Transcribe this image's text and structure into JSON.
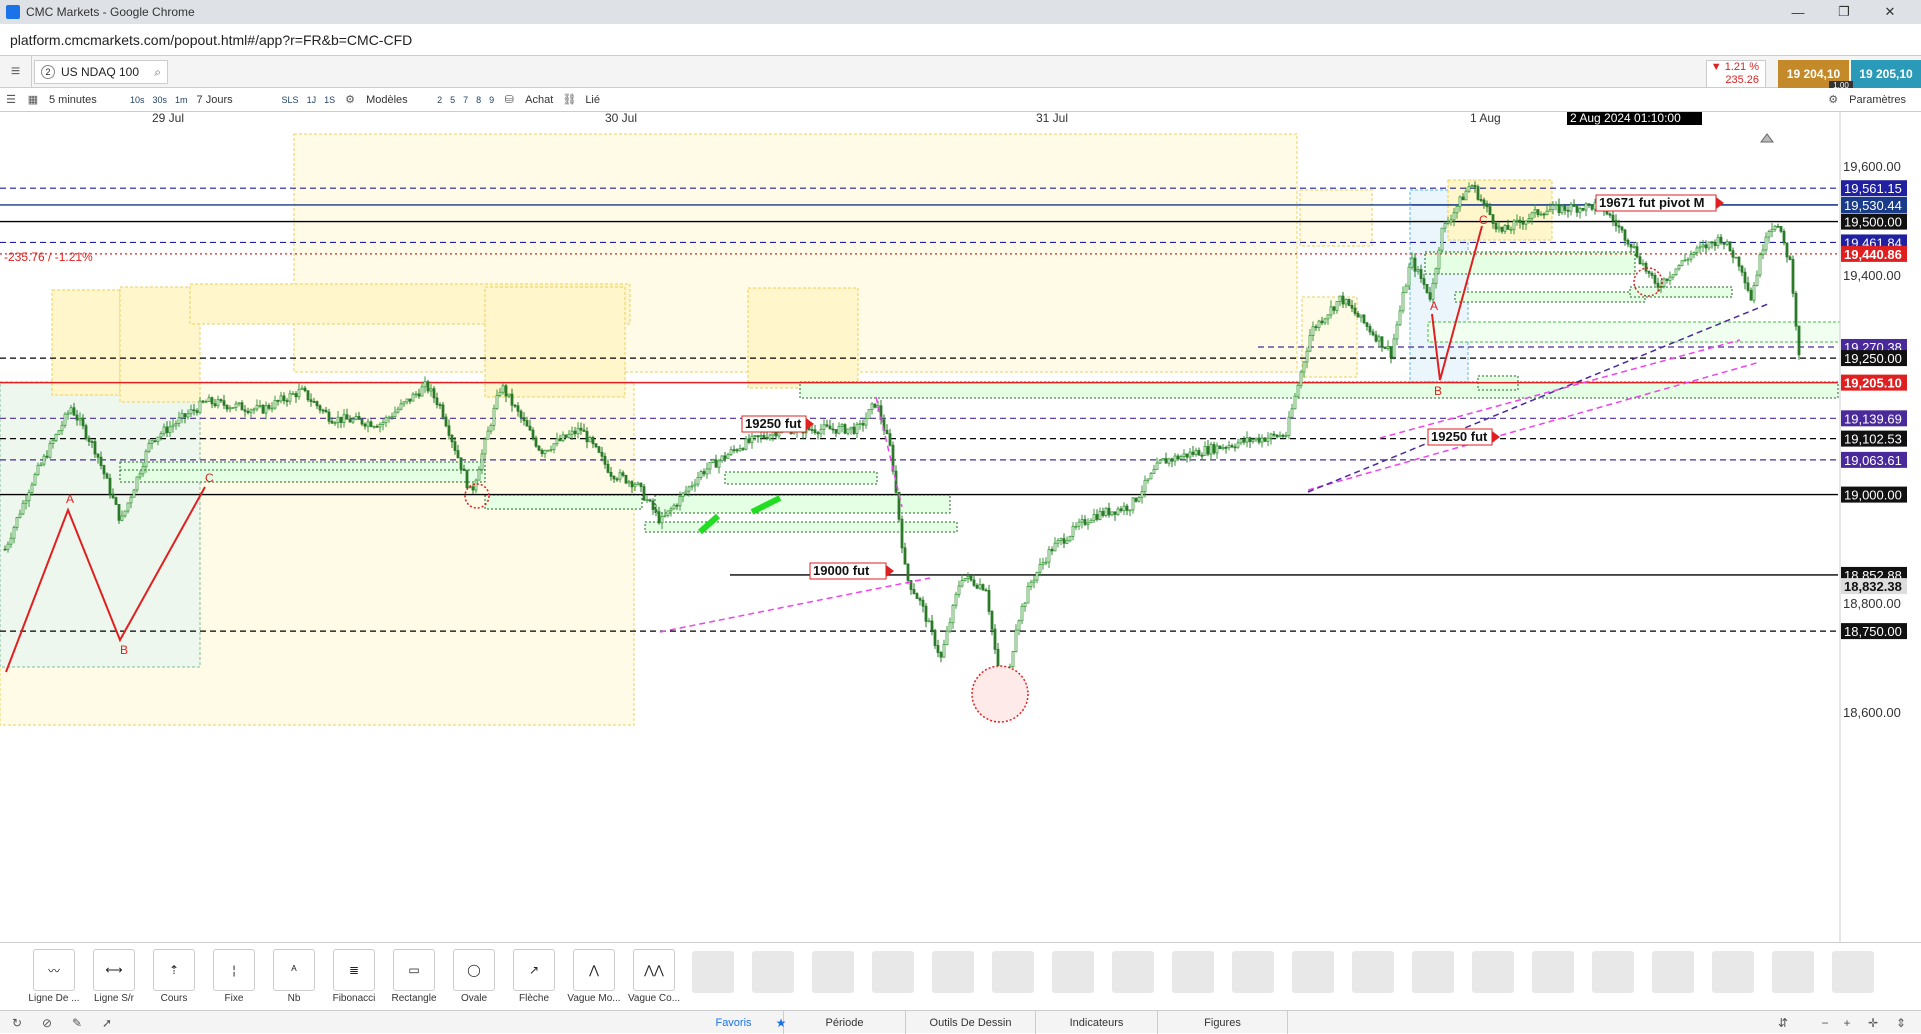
{
  "window": {
    "title": "CMC Markets - Google Chrome",
    "url": "platform.cmcmarkets.com/popout.html#/app?r=FR&b=CMC-CFD"
  },
  "instrument": {
    "tab_number": "2",
    "name": "US NDAQ 100",
    "change_pct": "▼ 1.21 %",
    "change_pts": "235.26",
    "sell": "19 204,10",
    "buy": "19 205,10",
    "spread": "1.00"
  },
  "toolbar": {
    "interval": "5 minutes",
    "btn_10s": "10s",
    "btn_30s": "30s",
    "btn_1m": "1m",
    "range": "7 Jours",
    "sls": "SLS",
    "btn_1j": "1J",
    "btn_1s": "1S",
    "models": "Modèles",
    "n2": "2",
    "n5": "5",
    "n7": "7",
    "n8": "8",
    "n9": "9",
    "achat": "Achat",
    "lie": "Lié",
    "params": "Paramètres"
  },
  "chart_data": {
    "type": "candlestick",
    "x_labels": [
      "29 Jul",
      "30 Jul",
      "31 Jul",
      "1 Aug"
    ],
    "crosshair_time": "2 Aug 2024 01:10:00",
    "y_ticks": [
      "19,600.00",
      "19,400.00",
      "18,800.00",
      "18,600.00"
    ],
    "ylim": [
      18550,
      19720
    ],
    "change_label": "-235.76 / -1.21%",
    "price_levels": [
      {
        "label": "19,561.15",
        "value": 19561.15,
        "style": "dashed",
        "color": "#2020a0"
      },
      {
        "label": "19,530.44",
        "value": 19530.44,
        "style": "solid",
        "color": "#1a3a8a"
      },
      {
        "label": "19,500.00",
        "value": 19500,
        "style": "solid",
        "color": "#000000"
      },
      {
        "label": "19,461.84",
        "value": 19461.84,
        "style": "dashed",
        "color": "#2020a0"
      },
      {
        "label": "19,440.86",
        "value": 19440.86,
        "style": "dotted",
        "color": "#e02020"
      },
      {
        "label": "19,270.38",
        "value": 19270.38,
        "style": "dashed",
        "color": "#4a2a9a"
      },
      {
        "label": "19,250.00",
        "value": 19250,
        "style": "dashed",
        "color": "#000000"
      },
      {
        "label": "19,205.10",
        "value": 19205.1,
        "style": "solid",
        "color": "#e02020"
      },
      {
        "label": "19,139.69",
        "value": 19139.69,
        "style": "dashed",
        "color": "#4a2a9a"
      },
      {
        "label": "19,102.53",
        "value": 19102.53,
        "style": "dashed",
        "color": "#000000"
      },
      {
        "label": "19,063.61",
        "value": 19063.61,
        "style": "dashed",
        "color": "#4a2a9a"
      },
      {
        "label": "19,000.00",
        "value": 19000,
        "style": "solid",
        "color": "#000000"
      },
      {
        "label": "18,852.88",
        "value": 18852.88,
        "style": "solid",
        "color": "#000000"
      },
      {
        "label": "18,832.38",
        "value": 18832.38,
        "style": "solid",
        "color": "#dddddd"
      },
      {
        "label": "18,750.00",
        "value": 18750,
        "style": "dashed",
        "color": "#000000"
      }
    ],
    "annotations": [
      "19250 fut",
      "19000 fut",
      "19250 fut",
      "19671 fut pivot M"
    ],
    "pattern_labels": [
      "A",
      "B",
      "C",
      "A",
      "B",
      "C"
    ]
  },
  "tools": {
    "items": [
      "Ligne De ...",
      "Ligne S/r",
      "Cours",
      "Fixe",
      "Nb",
      "Fibonacci",
      "Rectangle",
      "Ovale",
      "Flèche",
      "Vague Mo...",
      "Vague Co..."
    ]
  },
  "footer": {
    "tabs": [
      "Favoris",
      "Période",
      "Outils De Dessin",
      "Indicateurs",
      "Figures"
    ]
  },
  "colors": {
    "up_candle": "#3a9a3a",
    "down_candle": "#2a7a2a",
    "accent": "#1a73e8",
    "sell": "#c48a2a",
    "buy": "#2a9ab8"
  }
}
